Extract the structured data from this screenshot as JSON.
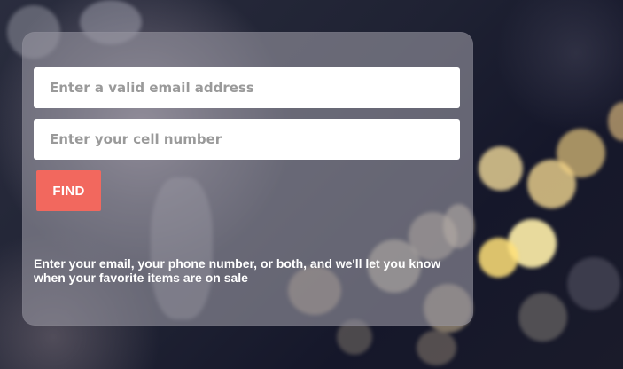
{
  "form": {
    "email_placeholder": "Enter a valid email address",
    "phone_placeholder": "Enter your cell number",
    "find_label": "FIND",
    "help_text": "Enter your email, your phone number, or both, and we'll let you know when your favorite items are on sale"
  },
  "colors": {
    "accent_button": "#f2685e",
    "panel": "rgba(150,148,160,0.62)"
  }
}
